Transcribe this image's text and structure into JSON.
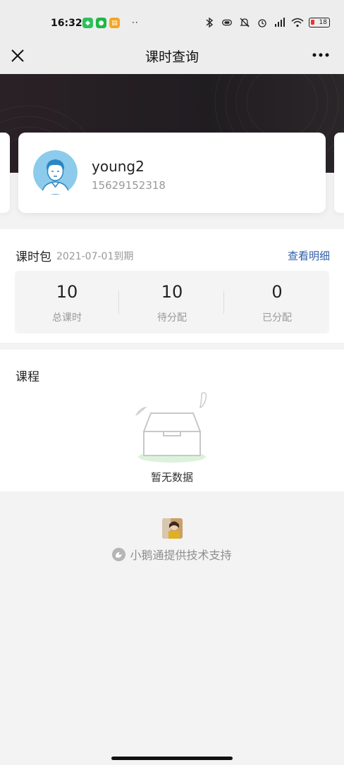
{
  "status_bar": {
    "time": "16:32",
    "more_dots": "··",
    "battery_level": "18"
  },
  "nav": {
    "title": "课时查询"
  },
  "profile": {
    "name": "young2",
    "phone": "15629152318"
  },
  "package": {
    "title": "课时包",
    "expire_text": "2021-07-01到期",
    "detail_link": "查看明细",
    "stats": [
      {
        "value": "10",
        "label": "总课时"
      },
      {
        "value": "10",
        "label": "待分配"
      },
      {
        "value": "0",
        "label": "已分配"
      }
    ]
  },
  "course": {
    "title": "课程",
    "empty_text": "暂无数据"
  },
  "footer": {
    "brand_text": "小鹅通提供技术支持"
  },
  "colors": {
    "link": "#2f5fa8",
    "banner": "#221e22",
    "avatar_bg": "#8ccbec"
  },
  "icons": [
    "close-icon",
    "more-icon",
    "bluetooth-icon",
    "bell-off-icon",
    "alarm-icon",
    "signal-icon",
    "wifi-icon",
    "battery-icon",
    "empty-box-icon",
    "xiaoe-logo-icon"
  ]
}
